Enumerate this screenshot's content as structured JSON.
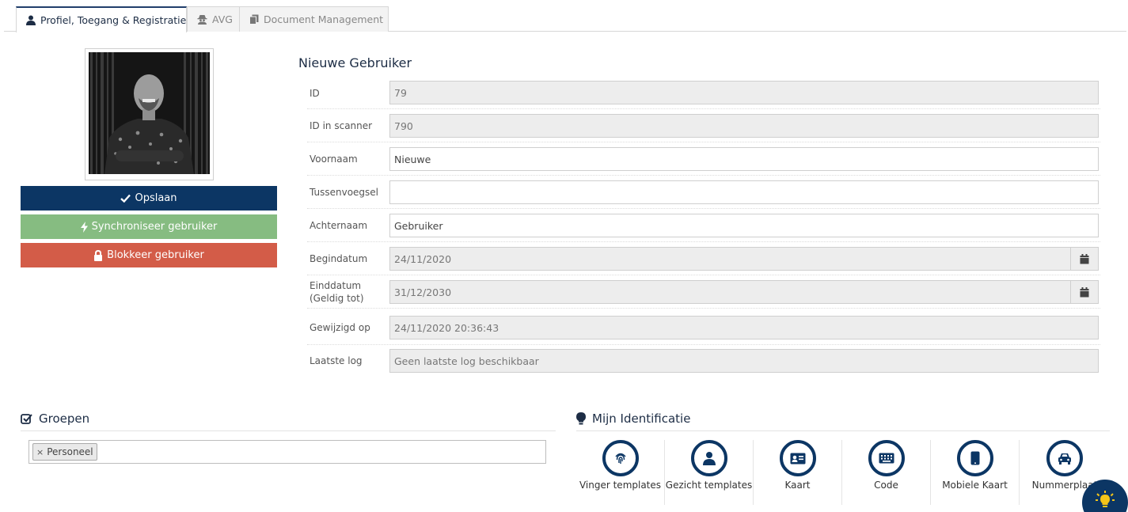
{
  "tabs": [
    {
      "label": "Profiel, Toegang & Registratie",
      "icon": "user-icon",
      "active": true
    },
    {
      "label": "AVG",
      "icon": "user-secret-icon",
      "active": false
    },
    {
      "label": "Document Management",
      "icon": "copy-icon",
      "active": false
    }
  ],
  "actions": {
    "save_label": "Opslaan",
    "sync_label": "Synchroniseer gebruiker",
    "block_label": "Blokkeer gebruiker"
  },
  "form": {
    "title": "Nieuwe Gebruiker",
    "fields": [
      {
        "label": "ID",
        "value": "79"
      },
      {
        "label": "ID in scanner",
        "value": "790"
      },
      {
        "label": "Voornaam",
        "value": "Nieuwe"
      },
      {
        "label": "Tussenvoegsel",
        "value": ""
      },
      {
        "label": "Achternaam",
        "value": "Gebruiker"
      },
      {
        "label": "Begindatum",
        "value": "24/11/2020"
      },
      {
        "label": "Einddatum (Geldig tot)",
        "value": "31/12/2030"
      },
      {
        "label": "Gewijzigd op",
        "value": "24/11/2020 20:36:43"
      },
      {
        "label": "Laatste log",
        "value": "Geen laatste log beschikbaar"
      }
    ]
  },
  "groups": {
    "title": "Groepen",
    "chips": [
      {
        "remove": "×",
        "label": "Personeel"
      }
    ]
  },
  "identification": {
    "title": "Mijn Identificatie",
    "items": [
      {
        "label": "Vinger templates",
        "icon": "fingerprint-icon"
      },
      {
        "label": "Gezicht templates",
        "icon": "face-user-icon"
      },
      {
        "label": "Kaart",
        "icon": "id-card-icon"
      },
      {
        "label": "Code",
        "icon": "keyboard-icon"
      },
      {
        "label": "Mobiele Kaart",
        "icon": "mobile-icon"
      },
      {
        "label": "Nummerplaat",
        "icon": "car-icon"
      }
    ]
  },
  "colors": {
    "primary": "#0c3664",
    "success": "#86bc81",
    "danger": "#d35c48",
    "accent": "#f5c518"
  }
}
